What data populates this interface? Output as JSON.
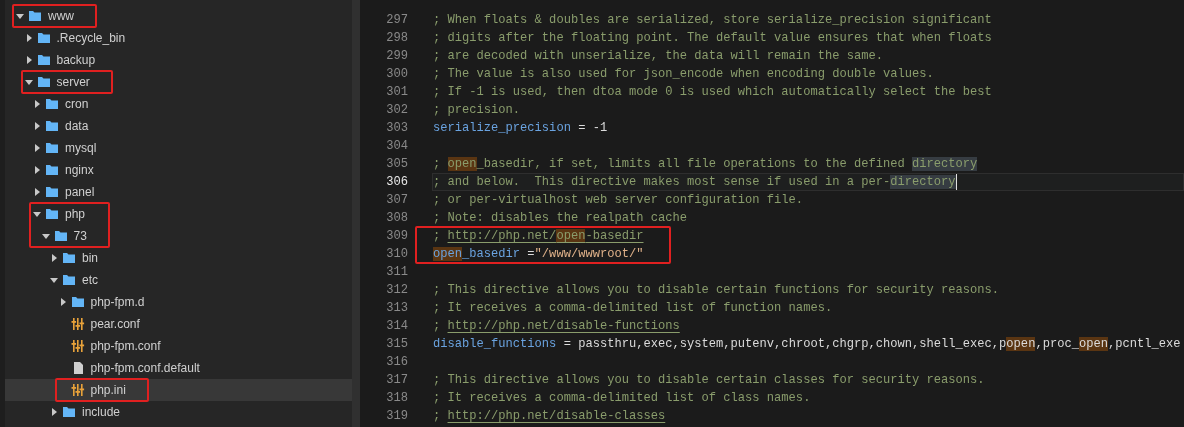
{
  "file_tree": [
    {
      "name": "www",
      "kind": "folder",
      "expanded": true,
      "selected": false,
      "annotated": true,
      "children": [
        {
          "name": ".Recycle_bin",
          "kind": "folder",
          "expanded": false,
          "selected": false,
          "annotated": false
        },
        {
          "name": "backup",
          "kind": "folder",
          "expanded": false,
          "selected": false,
          "annotated": false
        },
        {
          "name": "server",
          "kind": "folder",
          "expanded": true,
          "selected": false,
          "annotated": true,
          "children": [
            {
              "name": "cron",
              "kind": "folder",
              "expanded": false,
              "selected": false,
              "annotated": false
            },
            {
              "name": "data",
              "kind": "folder",
              "expanded": false,
              "selected": false,
              "annotated": false
            },
            {
              "name": "mysql",
              "kind": "folder",
              "expanded": false,
              "selected": false,
              "annotated": false
            },
            {
              "name": "nginx",
              "kind": "folder",
              "expanded": false,
              "selected": false,
              "annotated": false
            },
            {
              "name": "panel",
              "kind": "folder",
              "expanded": false,
              "selected": false,
              "annotated": false
            },
            {
              "name": "php",
              "kind": "folder",
              "expanded": true,
              "selected": false,
              "annotated": true,
              "children": [
                {
                  "name": "73",
                  "kind": "folder",
                  "expanded": true,
                  "selected": false,
                  "annotated": true,
                  "children": [
                    {
                      "name": "bin",
                      "kind": "folder",
                      "expanded": false,
                      "selected": false,
                      "annotated": false
                    },
                    {
                      "name": "etc",
                      "kind": "folder",
                      "expanded": true,
                      "selected": false,
                      "annotated": false,
                      "children": [
                        {
                          "name": "php-fpm.d",
                          "kind": "folder",
                          "expanded": false,
                          "selected": false,
                          "annotated": false
                        },
                        {
                          "name": "pear.conf",
                          "kind": "config",
                          "selected": false,
                          "annotated": false
                        },
                        {
                          "name": "php-fpm.conf",
                          "kind": "config",
                          "selected": false,
                          "annotated": false
                        },
                        {
                          "name": "php-fpm.conf.default",
                          "kind": "file",
                          "selected": false,
                          "annotated": false
                        },
                        {
                          "name": "php.ini",
                          "kind": "config",
                          "selected": true,
                          "annotated": true
                        }
                      ]
                    },
                    {
                      "name": "include",
                      "kind": "folder",
                      "expanded": false,
                      "selected": false,
                      "annotated": false
                    }
                  ]
                }
              ]
            }
          ]
        }
      ]
    }
  ],
  "editor": {
    "lines": [
      {
        "number": "297",
        "current": false,
        "annotated": false,
        "segments": [
          {
            "kind": "comment",
            "text": "; When floats & doubles are serialized, store serialize_precision significant"
          }
        ]
      },
      {
        "number": "298",
        "current": false,
        "annotated": false,
        "segments": [
          {
            "kind": "comment",
            "text": "; digits after the floating point. The default value ensures that when floats"
          }
        ]
      },
      {
        "number": "299",
        "current": false,
        "annotated": false,
        "segments": [
          {
            "kind": "comment",
            "text": "; are decoded with unserialize, the data will remain the same."
          }
        ]
      },
      {
        "number": "300",
        "current": false,
        "annotated": false,
        "segments": [
          {
            "kind": "comment",
            "text": "; The value is also used for json_encode when encoding double values."
          }
        ]
      },
      {
        "number": "301",
        "current": false,
        "annotated": false,
        "segments": [
          {
            "kind": "comment",
            "text": "; If -1 is used, then dtoa mode 0 is used which automatically select the best"
          }
        ]
      },
      {
        "number": "302",
        "current": false,
        "annotated": false,
        "segments": [
          {
            "kind": "comment",
            "text": "; precision."
          }
        ]
      },
      {
        "number": "303",
        "current": false,
        "annotated": false,
        "segments": [
          {
            "kind": "key",
            "text": "serialize_precision"
          },
          {
            "kind": "plain",
            "text": " = -1"
          }
        ]
      },
      {
        "number": "304",
        "current": false,
        "annotated": false
      },
      {
        "number": "305",
        "current": false,
        "annotated": false,
        "segments": [
          {
            "kind": "comment",
            "text": "; "
          },
          {
            "kind": "comment",
            "text": "open",
            "search_match": true
          },
          {
            "kind": "comment",
            "text": "_basedir, if set, limits all file operations to the defined "
          },
          {
            "kind": "comment",
            "text": "directory",
            "occurrence": true
          }
        ]
      },
      {
        "number": "306",
        "current": true,
        "annotated": false,
        "segments": [
          {
            "kind": "comment",
            "text": "; and below.  This directive makes most sense if used in a per-"
          },
          {
            "kind": "comment",
            "text": "directory",
            "occurrence": true
          }
        ]
      },
      {
        "number": "307",
        "current": false,
        "annotated": false,
        "segments": [
          {
            "kind": "comment",
            "text": "; or per-virtualhost web server configuration file."
          }
        ]
      },
      {
        "number": "308",
        "current": false,
        "annotated": false,
        "segments": [
          {
            "kind": "comment",
            "text": "; Note: disables the realpath cache"
          }
        ]
      },
      {
        "number": "309",
        "current": false,
        "annotated": true,
        "segments": [
          {
            "kind": "comment",
            "text": "; "
          },
          {
            "kind": "link",
            "text": "http://php.net/"
          },
          {
            "kind": "link",
            "text": "open",
            "search_match": true
          },
          {
            "kind": "link",
            "text": "-basedir"
          }
        ]
      },
      {
        "number": "310",
        "current": false,
        "annotated": true,
        "segments": [
          {
            "kind": "key",
            "text": "open",
            "search_match": true
          },
          {
            "kind": "key",
            "text": "_basedir"
          },
          {
            "kind": "plain",
            "text": " ="
          },
          {
            "kind": "string",
            "text": "\"/www/wwwroot/\""
          }
        ]
      },
      {
        "number": "311",
        "current": false,
        "annotated": false
      },
      {
        "number": "312",
        "current": false,
        "annotated": false,
        "segments": [
          {
            "kind": "comment",
            "text": "; This directive allows you to disable certain functions for security reasons."
          }
        ]
      },
      {
        "number": "313",
        "current": false,
        "annotated": false,
        "segments": [
          {
            "kind": "comment",
            "text": "; It receives a comma-delimited list of function names."
          }
        ]
      },
      {
        "number": "314",
        "current": false,
        "annotated": false,
        "segments": [
          {
            "kind": "comment",
            "text": "; "
          },
          {
            "kind": "link",
            "text": "http://php.net/disable-functions"
          }
        ]
      },
      {
        "number": "315",
        "current": false,
        "annotated": false,
        "segments": [
          {
            "kind": "key",
            "text": "disable_functions"
          },
          {
            "kind": "plain",
            "text": " = passthru,exec,system,putenv,chroot,chgrp,chown,shell_exec,p"
          },
          {
            "kind": "plain",
            "text": "open",
            "search_match": true
          },
          {
            "kind": "plain",
            "text": ",proc_"
          },
          {
            "kind": "plain",
            "text": "open",
            "search_match": true
          },
          {
            "kind": "plain",
            "text": ",pcntl_exe"
          }
        ]
      },
      {
        "number": "316",
        "current": false,
        "annotated": false
      },
      {
        "number": "317",
        "current": false,
        "annotated": false,
        "segments": [
          {
            "kind": "comment",
            "text": "; This directive allows you to disable certain classes for security reasons."
          }
        ]
      },
      {
        "number": "318",
        "current": false,
        "annotated": false,
        "segments": [
          {
            "kind": "comment",
            "text": "; It receives a comma-delimited list of class names."
          }
        ]
      },
      {
        "number": "319",
        "current": false,
        "annotated": false,
        "segments": [
          {
            "kind": "comment",
            "text": "; "
          },
          {
            "kind": "link",
            "text": "http://php.net/disable-classes"
          }
        ]
      }
    ]
  }
}
